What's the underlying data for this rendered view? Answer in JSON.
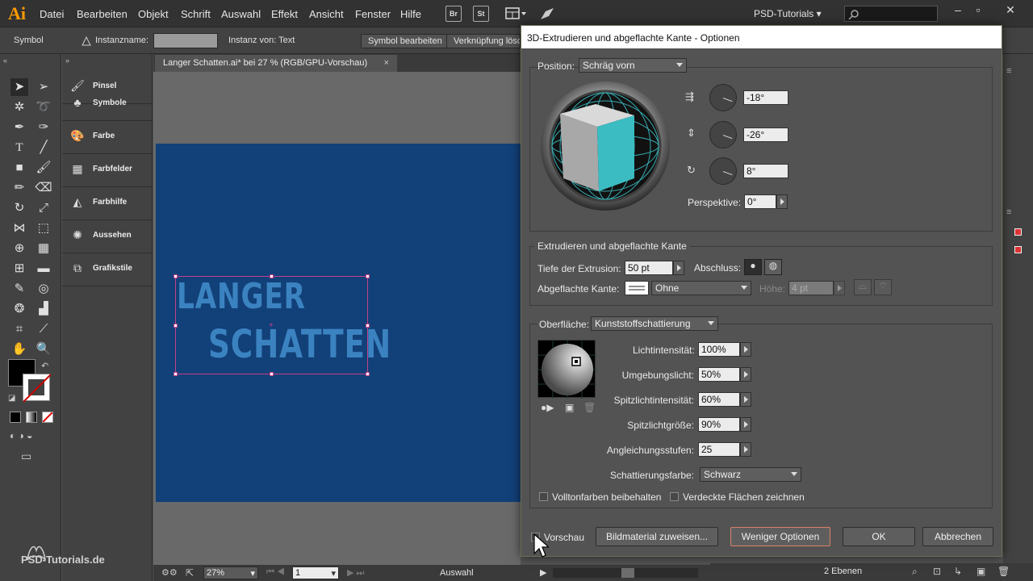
{
  "app": {
    "logo": "Ai",
    "menu": [
      "Datei",
      "Bearbeiten",
      "Objekt",
      "Schrift",
      "Auswahl",
      "Effekt",
      "Ansicht",
      "Fenster",
      "Hilfe"
    ],
    "bridge": "Br",
    "stock": "St",
    "workspace": "PSD-Tutorials"
  },
  "controlbar": {
    "selection_type": "Symbol",
    "instance_name_label": "Instanzname:",
    "instance_of": "Instanz von: Text",
    "edit_symbol": "Symbol bearbeiten",
    "break_link": "Verknüpfung lösch"
  },
  "panels": [
    {
      "label": "Pinsel"
    },
    {
      "label": "Symbole"
    },
    {
      "label": "Farbe"
    },
    {
      "label": "Farbfelder"
    },
    {
      "label": "Farbhilfe"
    },
    {
      "label": "Aussehen"
    },
    {
      "label": "Grafikstile"
    }
  ],
  "document": {
    "tab": "Langer Schatten.ai* bei 27 % (RGB/GPU-Vorschau)",
    "art_line1": "LANGER",
    "art_line2": "SCHATTEN",
    "zoom": "27%",
    "artboard": "1",
    "status": "Auswahl",
    "layers": "2 Ebenen"
  },
  "watermark": "PSD-Tutorials.de",
  "dialog": {
    "title": "3D-Extrudieren und abgeflachte Kante - Optionen",
    "position_label": "Position:",
    "position_value": "Schräg vorn",
    "rot_x": "-18°",
    "rot_y": "-26°",
    "rot_z": "8°",
    "perspective_label": "Perspektive:",
    "perspective_value": "0°",
    "extrude_group": "Extrudieren und abgeflachte Kante",
    "depth_label": "Tiefe der Extrusion:",
    "depth_value": "50 pt",
    "cap_label": "Abschluss:",
    "bevel_label": "Abgeflachte Kante:",
    "bevel_value": "Ohne",
    "height_label": "Höhe:",
    "height_value": "4 pt",
    "surface_label": "Oberfläche:",
    "surface_value": "Kunststoffschattierung",
    "light_intensity_label": "Lichtintensität:",
    "light_intensity": "100%",
    "ambient_label": "Umgebungslicht:",
    "ambient": "50%",
    "highlight_intensity_label": "Spitzlichtintensität:",
    "highlight_intensity": "60%",
    "highlight_size_label": "Spitzlichtgröße:",
    "highlight_size": "90%",
    "blend_steps_label": "Angleichungsstufen:",
    "blend_steps": "25",
    "shading_color_label": "Schattierungsfarbe:",
    "shading_color": "Schwarz",
    "preserve_spot": "Volltonfarben beibehalten",
    "draw_hidden": "Verdeckte Flächen zeichnen",
    "preview": "Vorschau",
    "map_art": "Bildmaterial zuweisen...",
    "fewer_options": "Weniger Optionen",
    "ok": "OK",
    "cancel": "Abbrechen"
  },
  "colors": {
    "artboard": "#124079",
    "art_text": "#3b83c0",
    "cube_front": "#3bbcc2",
    "selection": "#c2418b"
  }
}
